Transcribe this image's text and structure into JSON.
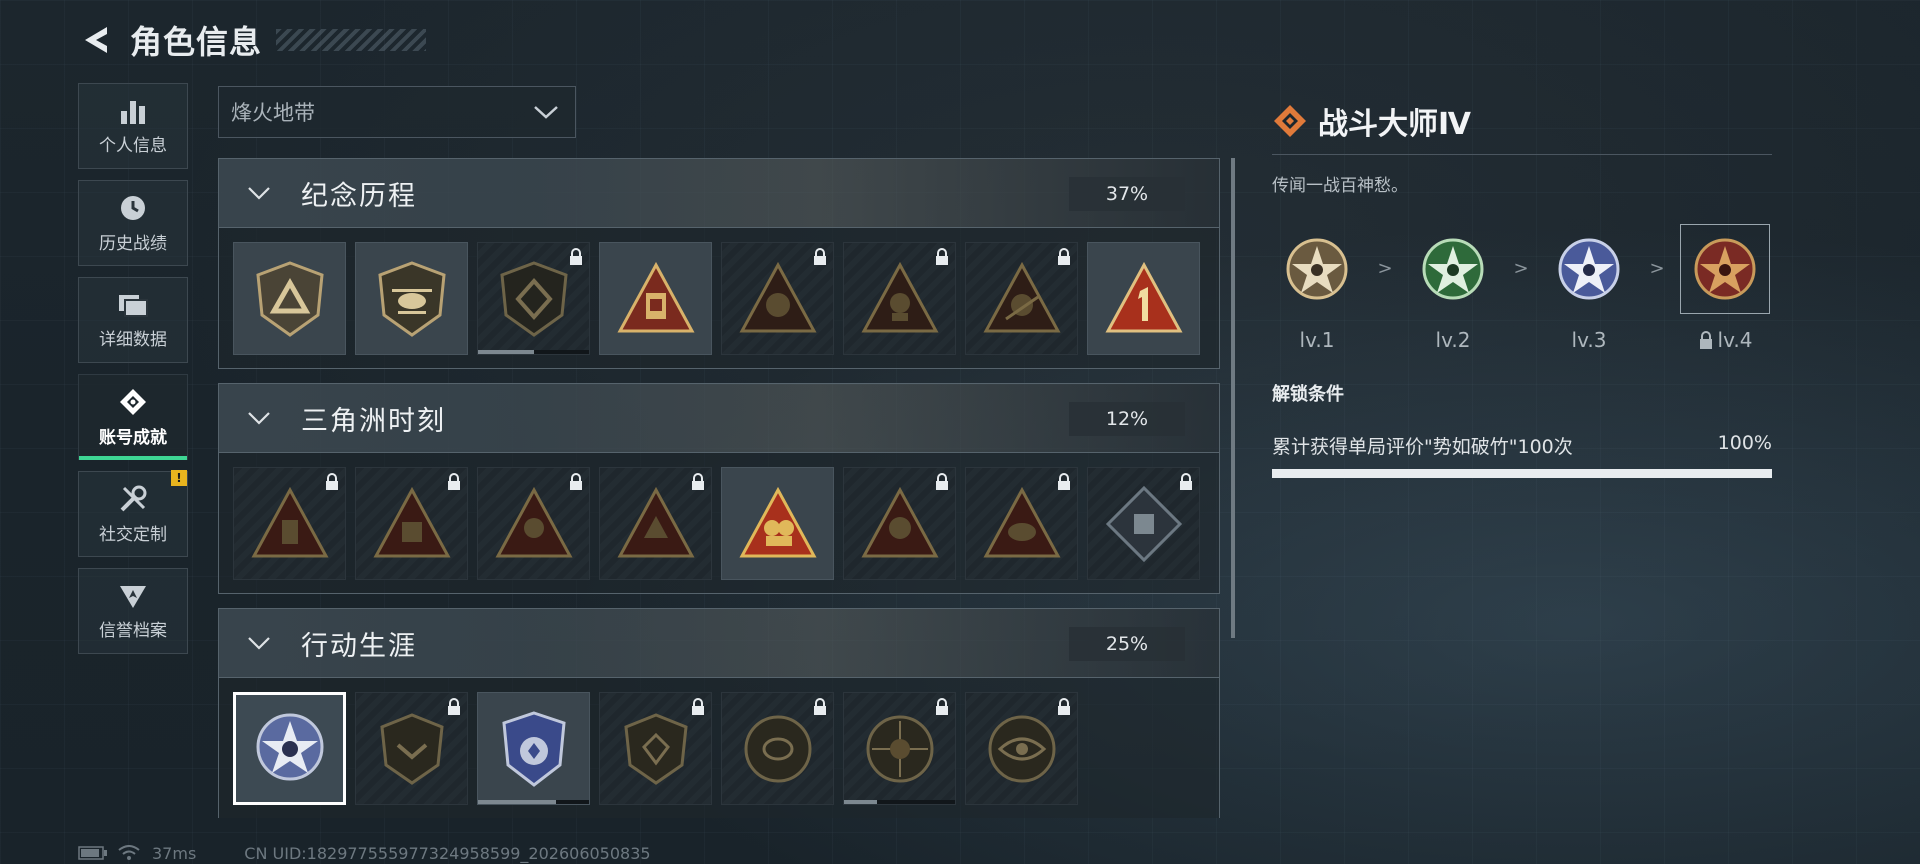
{
  "header": {
    "title": "角色信息"
  },
  "sidebar": {
    "items": [
      {
        "label": "个人信息",
        "icon": "bar-chart-icon"
      },
      {
        "label": "历史战绩",
        "icon": "clock-icon"
      },
      {
        "label": "详细数据",
        "icon": "folder-icon"
      },
      {
        "label": "账号成就",
        "icon": "achievement-icon",
        "active": true
      },
      {
        "label": "社交定制",
        "icon": "tools-icon",
        "warning": "!"
      },
      {
        "label": "信誉档案",
        "icon": "reputation-icon"
      }
    ]
  },
  "filter": {
    "selected": "烽火地带"
  },
  "sections": [
    {
      "name": "纪念历程",
      "percent": "37%"
    },
    {
      "name": "三角洲时刻",
      "percent": "12%"
    },
    {
      "name": "行动生涯",
      "percent": "25%"
    }
  ],
  "detail": {
    "title": "战斗大师Ⅳ",
    "description": "传闻一战百神愁。",
    "levels": [
      "lv.1",
      "lv.2",
      "lv.3",
      "lv.4"
    ],
    "level_separator": ">",
    "condition_title": "解锁条件",
    "condition_text": "累计获得单局评价\"势如破竹\"100次",
    "condition_percent": "100%",
    "condition_progress": 1.0
  },
  "status": {
    "ping": "37ms",
    "uid": "CN UID:1829775559773249585​99_202606050835"
  },
  "colors": {
    "accent_green": "#3ed694",
    "warning_yellow": "#e8b41e",
    "title_icon_orange": "#e07a3a"
  }
}
